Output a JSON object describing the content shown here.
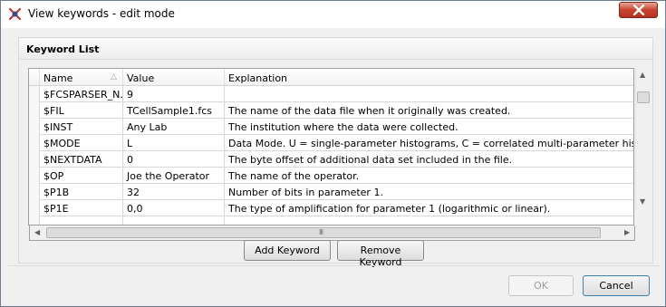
{
  "window": {
    "title": "View keywords - edit mode",
    "icon": "flowjo-app-icon",
    "close_icon": "close-icon"
  },
  "keyword_list": {
    "group_title": "Keyword List",
    "columns": [
      "Name",
      "Value",
      "Explanation"
    ],
    "sort_indicator": "△",
    "rows": [
      {
        "name": "$FCSPARSER_N...",
        "value": "9",
        "explanation": ""
      },
      {
        "name": "$FIL",
        "value": "TCellSample1.fcs",
        "explanation": "The name of the data file when it originally was created."
      },
      {
        "name": "$INST",
        "value": "Any Lab",
        "explanation": "The institution where the data were collected."
      },
      {
        "name": "$MODE",
        "value": "L",
        "explanation": "Data Mode.  U = single-parameter histograms, C = correlated multi-parameter histogr"
      },
      {
        "name": "$NEXTDATA",
        "value": "0",
        "explanation": "The byte offset of additional data set included in the file."
      },
      {
        "name": "$OP",
        "value": "Joe the Operator",
        "explanation": "The name of the operator."
      },
      {
        "name": "$P1B",
        "value": "32",
        "explanation": "Number of bits in parameter 1."
      },
      {
        "name": "$P1E",
        "value": "0,0",
        "explanation": "The type of amplification for parameter 1 (logarithmic or linear)."
      }
    ],
    "scroll_grip": "III"
  },
  "buttons": {
    "add_keyword": "Add Keyword",
    "remove_keyword": "Remove Keyword",
    "ok": "OK",
    "cancel": "Cancel"
  }
}
